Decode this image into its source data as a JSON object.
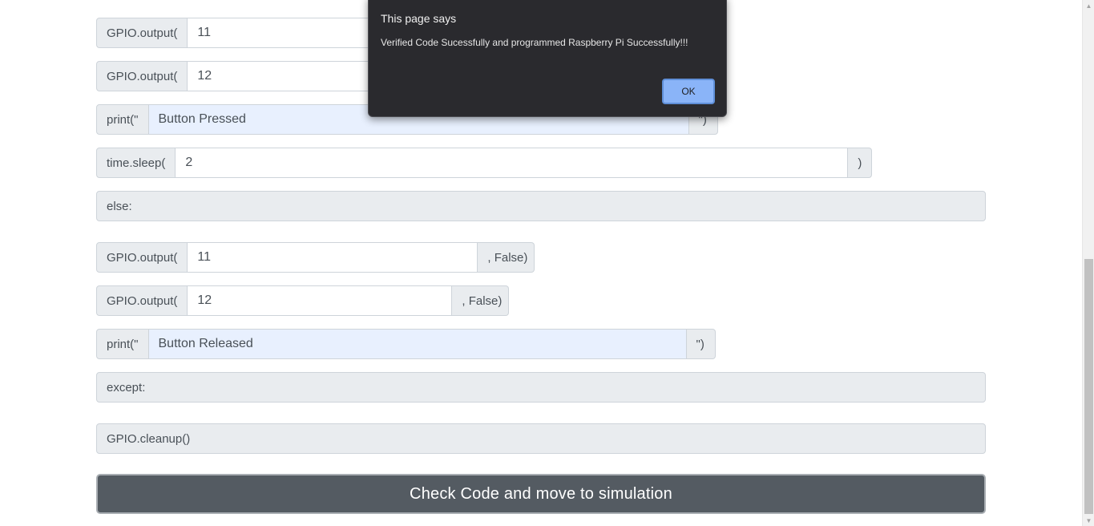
{
  "code_rows": [
    {
      "prefix": "GPIO.output(",
      "value": "11"
    },
    {
      "prefix": "GPIO.output(",
      "value": "12"
    },
    {
      "prefix": "print(\"",
      "value": "Button Pressed",
      "suffix": "\")"
    },
    {
      "prefix": "time.sleep(",
      "value": "2",
      "suffix": ")"
    },
    {
      "block": "else:"
    },
    {
      "prefix": "GPIO.output(",
      "value": "11",
      "suffix": ", False)"
    },
    {
      "prefix": "GPIO.output(",
      "value": "12",
      "suffix": ", False)"
    },
    {
      "prefix": "print(\"",
      "value": "Button Released",
      "suffix": "\")"
    },
    {
      "block": "except:"
    },
    {
      "block": "GPIO.cleanup()"
    }
  ],
  "submit_button": {
    "label": "Check Code and move to simulation"
  },
  "dialog": {
    "title": "This page says",
    "message": "Verified Code Sucessfully and programmed Raspberry Pi Successfully!!!",
    "ok_label": "OK"
  },
  "scrollbar": {
    "up_icon": "triangle-up-icon",
    "down_icon": "triangle-down-icon"
  }
}
